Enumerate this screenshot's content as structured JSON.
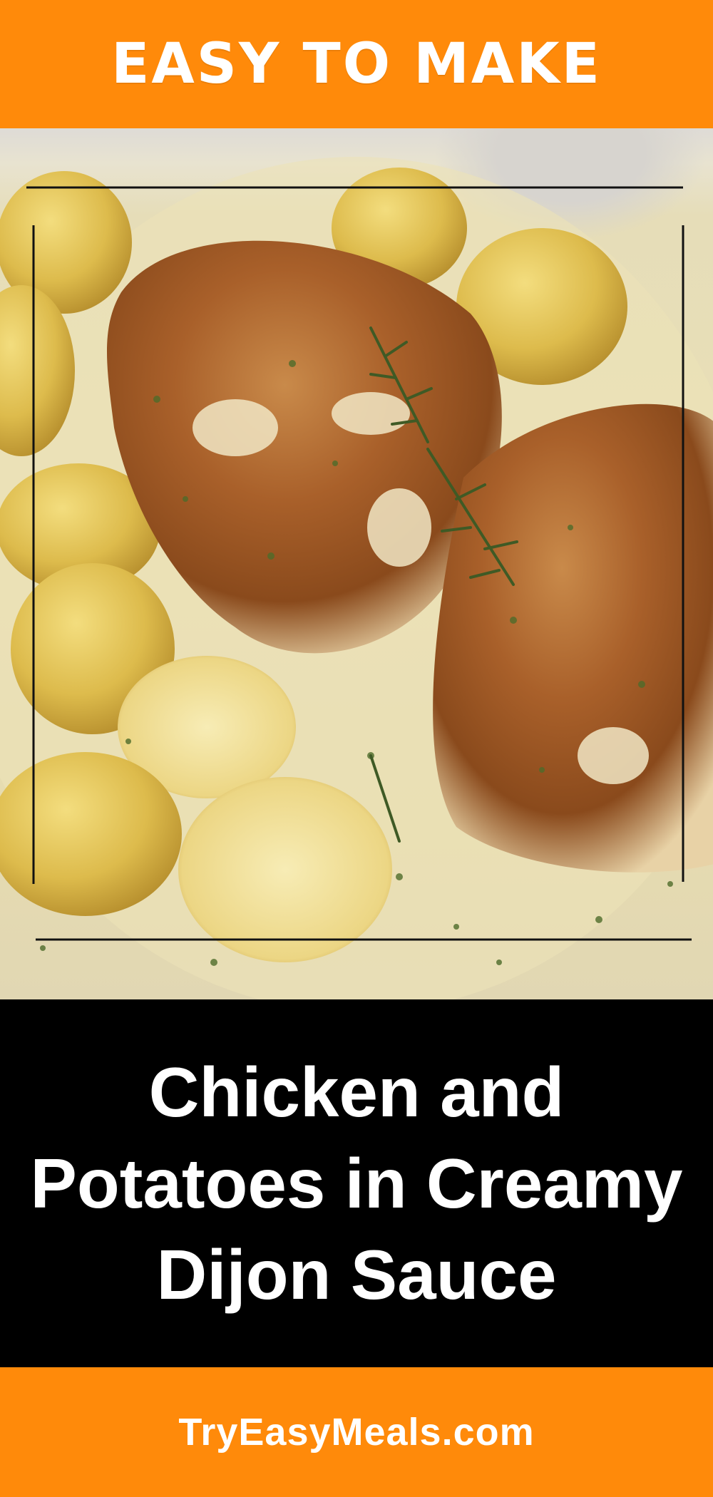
{
  "top_banner": {
    "text": "EASY TO MAKE"
  },
  "title": {
    "line1": "Chicken and",
    "line2": "Potatoes in Creamy",
    "line3": "Dijon Sauce"
  },
  "footer": {
    "site": "TryEasyMeals.com"
  },
  "colors": {
    "banner_orange": "#ff8a0a",
    "title_panel": "#000000",
    "text": "#ffffff"
  },
  "photo": {
    "subject": "pan-seared chicken breasts with halved baby potatoes, rosemary and herbs in creamy dijon sauce"
  }
}
